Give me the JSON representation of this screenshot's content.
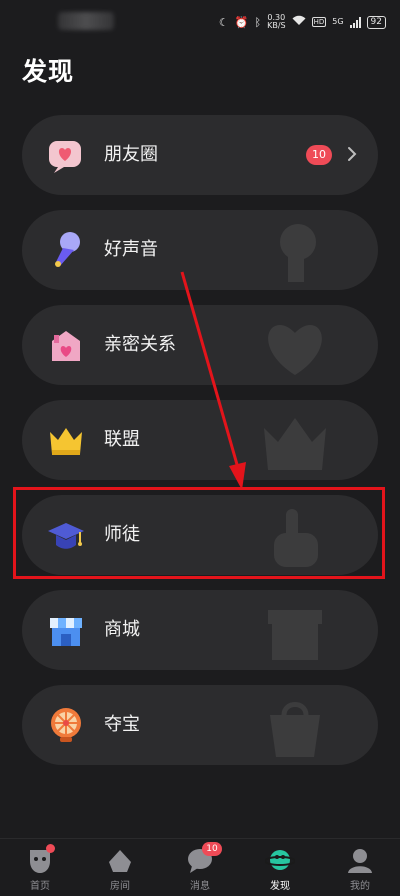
{
  "status_bar": {
    "network_speed": "0.30",
    "network_unit": "KB/S",
    "hd": "HD",
    "signal": "5G",
    "battery": "92"
  },
  "page": {
    "title": "发现"
  },
  "items": [
    {
      "label": "朋友圈",
      "icon": "moments-icon",
      "badge": "10",
      "chevron": true
    },
    {
      "label": "好声音",
      "icon": "microphone-icon"
    },
    {
      "label": "亲密关系",
      "icon": "relationship-icon"
    },
    {
      "label": "联盟",
      "icon": "crown-icon"
    },
    {
      "label": "师徒",
      "icon": "graduation-cap-icon",
      "highlighted": true
    },
    {
      "label": "商城",
      "icon": "shop-icon"
    },
    {
      "label": "夺宝",
      "icon": "lucky-wheel-icon"
    }
  ],
  "tabbar": [
    {
      "label": "首页",
      "icon": "home-mask-icon",
      "dot": true
    },
    {
      "label": "房间",
      "icon": "room-icon"
    },
    {
      "label": "消息",
      "icon": "message-icon",
      "badge": "10"
    },
    {
      "label": "发现",
      "icon": "discover-planet-icon",
      "active": true
    },
    {
      "label": "我的",
      "icon": "profile-icon"
    }
  ],
  "colors": {
    "background": "#1c1c1e",
    "card": "#2c2c2e",
    "badge": "#ef4b57",
    "highlight": "#e3141b",
    "active_tab": "#27c6a0"
  }
}
